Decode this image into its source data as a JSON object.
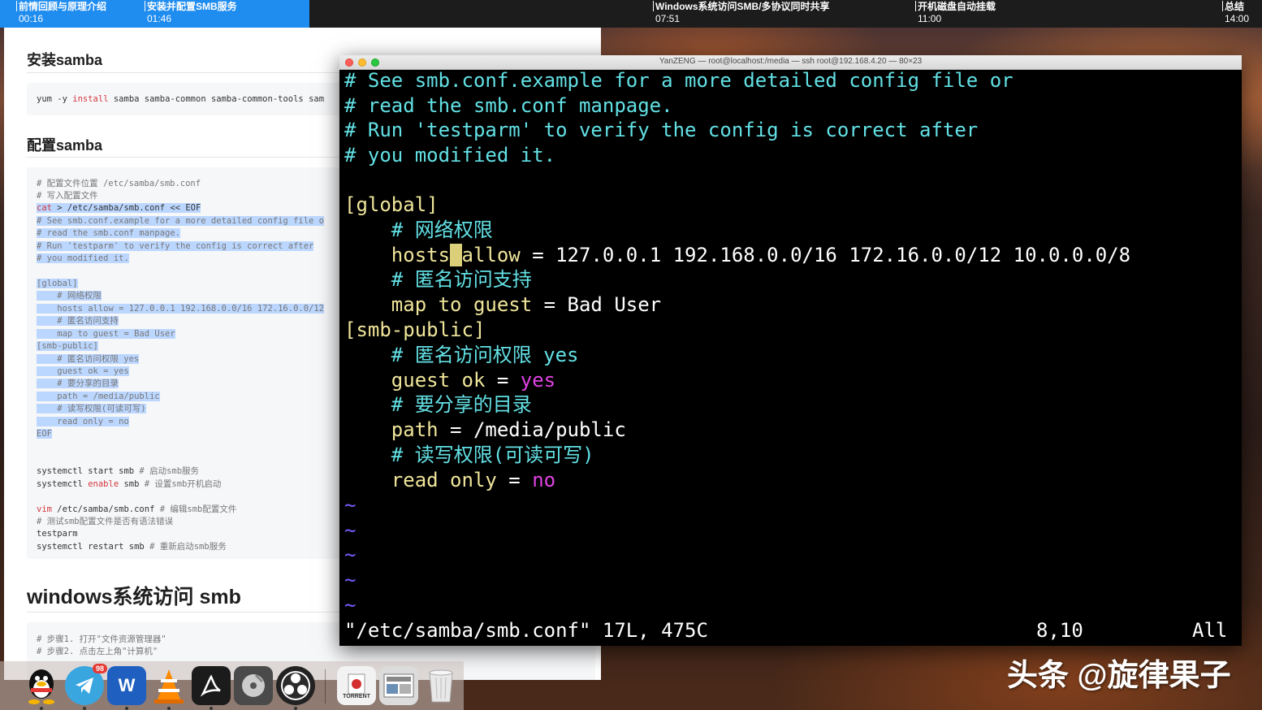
{
  "timeline": {
    "chapters": [
      {
        "title": "前情回顾与原理介绍",
        "time": "00:16"
      },
      {
        "title": "安装并配置SMB服务",
        "time": "01:46"
      },
      {
        "title": "Windows系统访问SMB/多协议同时共享",
        "time": "07:51"
      },
      {
        "title": "开机磁盘自动挂载",
        "time": "11:00"
      },
      {
        "title": "总结",
        "time": "14:00"
      }
    ]
  },
  "doc": {
    "install_heading": "安装samba",
    "install_cmd": {
      "pre": "yum -y ",
      "kw": "install",
      "post": " samba samba-common samba-common-tools sam"
    },
    "config_heading": "配置samba",
    "config_lines": {
      "l1": "# 配置文件位置 /etc/samba/smb.conf",
      "l2": "# 写入配置文件",
      "l3_kw": "cat",
      "l3_rest": " > /etc/samba/smb.conf << EOF",
      "l4": "# See smb.conf.example for a more detailed config file o",
      "l5": "# read the smb.conf manpage.",
      "l6": "# Run 'testparm' to verify the config is correct after",
      "l7": "# you modified it.",
      "l8": "[global]",
      "l9": "    # 网络权限",
      "l10": "    hosts allow = 127.0.0.1 192.168.0.0/16 172.16.0.0/12",
      "l11": "    # 匿名访问支持",
      "l12": "    map to guest = Bad User",
      "l13": "[smb-public]",
      "l14": "    # 匿名访问权限 yes",
      "l15": "    guest ok = yes",
      "l16": "    # 要分享的目录",
      "l17": "    path = /media/public",
      "l18": "    # 读写权限(可读可写)",
      "l19": "    read only = no",
      "l20": "EOF",
      "l21_cmd": "systemctl start smb",
      "l21_cmt": " # 启动smb服务",
      "l22_pre": "systemctl ",
      "l22_kw": "enable",
      "l22_post": " smb",
      "l22_cmt": " # 设置smb开机启动",
      "l23_kw": "vim",
      "l23_post": " /etc/samba/smb.conf",
      "l23_cmt": " # 编辑smb配置文件",
      "l24": "# 测试smb配置文件是否有语法错误",
      "l25": "testparm",
      "l26_cmd": "systemctl restart smb",
      "l26_cmt": " # 重新启动smb服务"
    },
    "windows_heading": "windows系统访问 smb",
    "windows_lines": {
      "w1": "# 步骤1. 打开\"文件资源管理器\"",
      "w2": "# 步骤2. 点击左上角\"计算机\""
    }
  },
  "terminal": {
    "title": "YanZENG — root@localhost:/media — ssh root@192.168.4.20 — 80×23",
    "lines": {
      "c1": "# See smb.conf.example for a more detailed config file or",
      "c2": "# read the smb.conf manpage.",
      "c3": "# Run 'testparm' to verify the config is correct after",
      "c4": "# you modified it.",
      "global": "[global]",
      "c5": "    # 网络权限",
      "hosts_a": "    hosts",
      "hosts_cursor": " ",
      "hosts_b": "allow",
      "hosts_c": " = 127.0.0.1 192.168.0.0/16 172.16.0.0/12 10.0.0.0/8",
      "c6": "    # 匿名访问支持",
      "map_a": "    map to guest",
      "map_b": " = Bad User",
      "public": "[smb-public]",
      "c7": "    # 匿名访问权限 yes",
      "guest_a": "    guest ok",
      "guest_b": " = ",
      "guest_c": "yes",
      "c8": "    # 要分享的目录",
      "path_a": "    path",
      "path_b": " = /media/public",
      "c9": "    # 读写权限(可读可写)",
      "ro_a": "    read only",
      "ro_b": " = ",
      "ro_c": "no",
      "tilde": "~"
    },
    "status": {
      "file": "\"/etc/samba/smb.conf\" 17L, 475C",
      "position": "8,10",
      "scroll": "All"
    }
  },
  "dock": {
    "icons": [
      "qq-icon",
      "telegram-icon",
      "word-icon",
      "vlc-icon",
      "acrobat-icon",
      "disk-utility-icon",
      "obs-icon",
      "torrent-icon",
      "screenshot-icon",
      "trash-icon"
    ],
    "telegram_badge": "98",
    "word_label": "W",
    "torrent_label": "TORRENT"
  },
  "watermark": "头条 @旋律果子",
  "colors": {
    "progress": "#1f8cf0",
    "term_comment": "#62e0e4",
    "term_section": "#efe59a",
    "term_value": "#e043e4",
    "term_tilde": "#7a5cff"
  }
}
